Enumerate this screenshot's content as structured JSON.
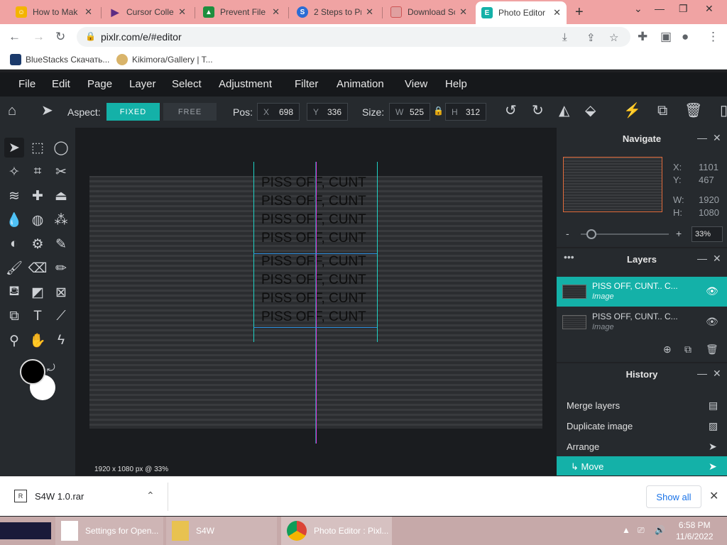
{
  "browser": {
    "tabs": [
      {
        "title": "How to Mak",
        "icon": "emoji-face-icon"
      },
      {
        "title": "Cursor Colle",
        "icon": "cursor-icon"
      },
      {
        "title": "Prevent File",
        "icon": "android-icon"
      },
      {
        "title": "2 Steps to Pr",
        "icon": "blue-s-icon"
      },
      {
        "title": "Download Sc",
        "icon": "mail-icon"
      },
      {
        "title": "Photo Editor",
        "icon": "pixlr-e-icon"
      }
    ],
    "url": "pixlr.com/e/#editor",
    "bookmarks": [
      "BlueStacks Скачать...",
      "Kikimora/Gallery | T..."
    ]
  },
  "menu": [
    "File",
    "Edit",
    "Page",
    "Layer",
    "Select",
    "Adjustment",
    "Filter",
    "Animation",
    "View",
    "Help"
  ],
  "toolbar": {
    "aspect_label": "Aspect:",
    "fixed_label": "FIXED",
    "free_label": "FREE",
    "pos_label": "Pos:",
    "x_label": "X",
    "x_value": "698",
    "y_label": "Y",
    "y_value": "336",
    "size_label": "Size:",
    "w_label": "W",
    "w_value": "525",
    "h_label": "H",
    "h_value": "312"
  },
  "canvas": {
    "lines": [
      "PISS OFF, CUNT",
      "PISS OFF, CUNT",
      "PISS OFF, CUNT",
      "PISS OFF, CUNT",
      "PISS OFF, CUNT",
      "PISS OFF, CUNT",
      "PISS OFF, CUNT",
      "PISS OFF, CUNT"
    ],
    "status": "1920 x 1080 px @ 33%"
  },
  "navigate": {
    "title": "Navigate",
    "x_label": "X:",
    "x_value": "1101",
    "y_label": "Y:",
    "y_value": "467",
    "w_label": "W:",
    "w_value": "1920",
    "h_label": "H:",
    "h_value": "1080",
    "zoom": "33%"
  },
  "layers": {
    "title": "Layers",
    "items": [
      {
        "name": "PISS OFF, CUNT.. C...",
        "type": "Image"
      },
      {
        "name": "PISS OFF, CUNT.. C...",
        "type": "Image"
      }
    ]
  },
  "history": {
    "title": "History",
    "items": [
      "Merge layers",
      "Duplicate image",
      "Arrange",
      "↳ Move"
    ]
  },
  "download": {
    "file": "S4W 1.0.rar",
    "show_all": "Show all"
  },
  "taskbar": {
    "apps": [
      "Settings for Open...",
      "S4W",
      "Photo Editor : Pixl..."
    ],
    "time": "6:58 PM",
    "date": "11/6/2022"
  },
  "colors": {
    "accent": "#14b1a8",
    "guide_cyan": "#1fd1c4",
    "guide_magenta": "#e135e1",
    "tab_bar": "#f0a3a3"
  }
}
